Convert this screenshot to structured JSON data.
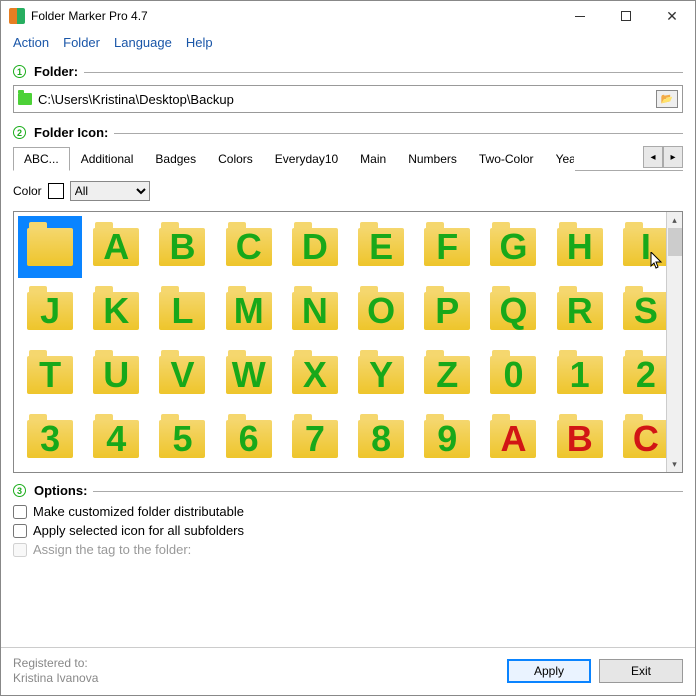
{
  "window": {
    "title": "Folder Marker Pro 4.7"
  },
  "menubar": [
    "Action",
    "Folder",
    "Language",
    "Help"
  ],
  "section1": {
    "badge": "1",
    "label": "Folder:"
  },
  "path": "C:\\Users\\Kristina\\Desktop\\Backup",
  "section2": {
    "badge": "2",
    "label": "Folder Icon:"
  },
  "tabs": [
    "ABC...",
    "Additional",
    "Badges",
    "Colors",
    "Everyday10",
    "Main",
    "Numbers",
    "Two-Color",
    "Year"
  ],
  "colorRow": {
    "label": "Color",
    "value": "All"
  },
  "icons": [
    {
      "t": "",
      "c": "green",
      "sel": true
    },
    {
      "t": "A",
      "c": "green"
    },
    {
      "t": "B",
      "c": "green"
    },
    {
      "t": "C",
      "c": "green"
    },
    {
      "t": "D",
      "c": "green"
    },
    {
      "t": "E",
      "c": "green"
    },
    {
      "t": "F",
      "c": "green"
    },
    {
      "t": "G",
      "c": "green"
    },
    {
      "t": "H",
      "c": "green"
    },
    {
      "t": "I",
      "c": "green"
    },
    {
      "t": "J",
      "c": "green"
    },
    {
      "t": "K",
      "c": "green"
    },
    {
      "t": "L",
      "c": "green"
    },
    {
      "t": "M",
      "c": "green"
    },
    {
      "t": "N",
      "c": "green"
    },
    {
      "t": "O",
      "c": "green"
    },
    {
      "t": "P",
      "c": "green"
    },
    {
      "t": "Q",
      "c": "green"
    },
    {
      "t": "R",
      "c": "green"
    },
    {
      "t": "S",
      "c": "green"
    },
    {
      "t": "T",
      "c": "green"
    },
    {
      "t": "U",
      "c": "green"
    },
    {
      "t": "V",
      "c": "green"
    },
    {
      "t": "W",
      "c": "green"
    },
    {
      "t": "X",
      "c": "green"
    },
    {
      "t": "Y",
      "c": "green"
    },
    {
      "t": "Z",
      "c": "green"
    },
    {
      "t": "0",
      "c": "green"
    },
    {
      "t": "1",
      "c": "green"
    },
    {
      "t": "2",
      "c": "green"
    },
    {
      "t": "3",
      "c": "green"
    },
    {
      "t": "4",
      "c": "green"
    },
    {
      "t": "5",
      "c": "green"
    },
    {
      "t": "6",
      "c": "green"
    },
    {
      "t": "7",
      "c": "green"
    },
    {
      "t": "8",
      "c": "green"
    },
    {
      "t": "9",
      "c": "green"
    },
    {
      "t": "A",
      "c": "red"
    },
    {
      "t": "B",
      "c": "red"
    },
    {
      "t": "C",
      "c": "red"
    }
  ],
  "section3": {
    "badge": "3",
    "label": "Options:"
  },
  "options": [
    {
      "label": "Make customized folder distributable",
      "checked": false,
      "disabled": false
    },
    {
      "label": "Apply selected icon for all subfolders",
      "checked": false,
      "disabled": false
    },
    {
      "label": "Assign the tag to the folder:",
      "checked": false,
      "disabled": true
    }
  ],
  "footer": {
    "reg1": "Registered to:",
    "reg2": "Kristina Ivanova",
    "apply": "Apply",
    "exit": "Exit"
  }
}
